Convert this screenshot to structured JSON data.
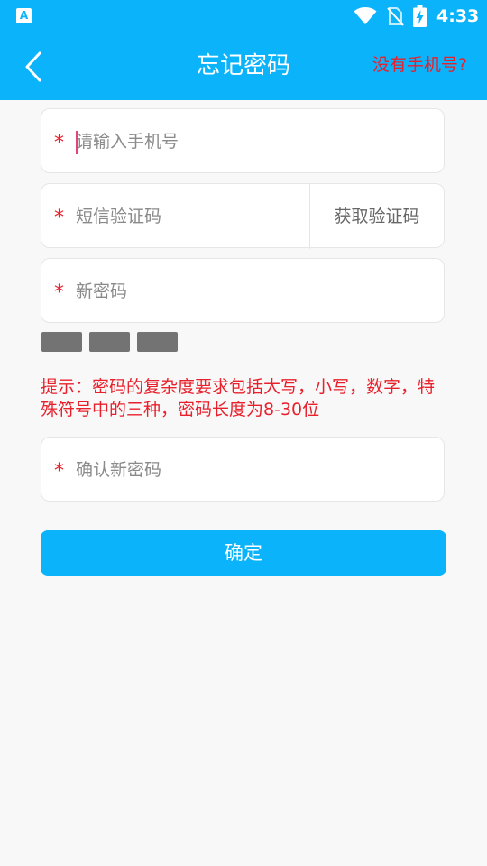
{
  "status_bar": {
    "app_badge": "A",
    "time": "4:33",
    "icons": [
      "wifi-icon",
      "no-sim-icon",
      "battery-charging-icon"
    ]
  },
  "app_bar": {
    "title": "忘记密码",
    "back_icon": "chevron-left-icon",
    "no_phone_link": "没有手机号?"
  },
  "form": {
    "required_mark": "*",
    "phone": {
      "value": "",
      "placeholder": "请输入手机号"
    },
    "sms_code": {
      "value": "",
      "placeholder": "短信验证码",
      "get_code_label": "获取验证码"
    },
    "new_password": {
      "value": "",
      "placeholder": "新密码"
    },
    "password_strength": {
      "segments": 3,
      "filled": 0
    },
    "hint": "提示：密码的复杂度要求包括大写，小写，数字，特殊符号中的三种，密码长度为8-30位",
    "confirm_password": {
      "value": "",
      "placeholder": "确认新密码"
    },
    "confirm_label": "确定"
  },
  "colors": {
    "primary": "#0bb3fb",
    "required": "#e8202c",
    "strength_bar": "#737373",
    "background": "#f8f8f8"
  }
}
